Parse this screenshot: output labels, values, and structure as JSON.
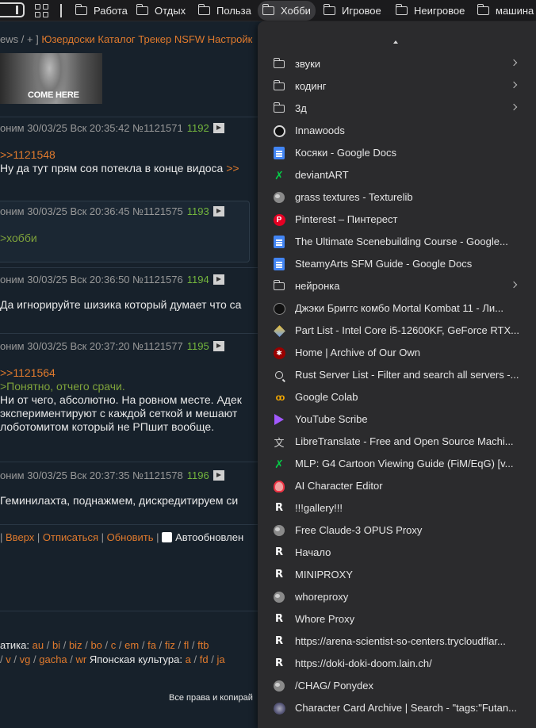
{
  "bookmarks_bar": {
    "items": [
      {
        "label": "Работа"
      },
      {
        "label": "Отдых"
      },
      {
        "label": "Польза"
      },
      {
        "label": "Хобби"
      },
      {
        "label": "Игровое"
      },
      {
        "label": "Неигровое"
      },
      {
        "label": "машина"
      }
    ]
  },
  "forum": {
    "topnav": {
      "prefix": "ews / + ]",
      "links": [
        "Юзердоски",
        "Каталог",
        "Трекер",
        "NSFW",
        "Настройк"
      ]
    },
    "thumb_caption": "COME HERE",
    "posts": [
      {
        "author": "оним",
        "date": "30/03/25 Вск 20:35:42",
        "postno": "№1121571",
        "index": "1192",
        "lines": [
          {
            "type": "reply",
            "text": ">>1121548"
          },
          {
            "type": "text",
            "text": "Ну да тут прям соя потекла в конце видоса",
            "trail": ">>"
          }
        ]
      },
      {
        "author": "оним",
        "date": "30/03/25 Вск 20:36:45",
        "postno": "№1121575",
        "index": "1193",
        "lines": [
          {
            "type": "quote",
            "text": ">хобби"
          }
        ]
      },
      {
        "author": "оним",
        "date": "30/03/25 Вск 20:36:50",
        "postno": "№1121576",
        "index": "1194",
        "lines": [
          {
            "type": "text",
            "text": "Да игнорируйте шизика который думает что са"
          }
        ]
      },
      {
        "author": "оним",
        "date": "30/03/25 Вск 20:37:20",
        "postno": "№1121577",
        "index": "1195",
        "lines": [
          {
            "type": "reply",
            "text": ">>1121564"
          },
          {
            "type": "quote",
            "text": ">Понятно, отчего срачи."
          },
          {
            "type": "text",
            "text": "Ни от чего, абсолютно. На ровном месте. Адек"
          },
          {
            "type": "text",
            "text": "экспериментируют с каждой сеткой и мешают"
          },
          {
            "type": "text",
            "text": "лоботомитом который не РПшит вообще."
          }
        ]
      },
      {
        "author": "оним",
        "date": "30/03/25 Вск 20:37:35",
        "postno": "№1121578",
        "index": "1196",
        "lines": [
          {
            "type": "text",
            "text": "Геминилахта, поднажмем, дискредитируем си"
          }
        ]
      }
    ],
    "bottom_links": {
      "links": [
        "Вверх",
        "Отписаться",
        "Обновить"
      ],
      "autoupdate_label": "Автообновлен"
    },
    "boards_line1": {
      "prefix": "атика:",
      "boards": [
        "au",
        "bi",
        "biz",
        "bo",
        "c",
        "em",
        "fa",
        "fiz",
        "fl",
        "ftb"
      ]
    },
    "boards_line2": {
      "boards_a": [
        "v",
        "vg",
        "gacha",
        "wr"
      ],
      "middle": "Японская культура:",
      "boards_b": [
        "a",
        "fd",
        "ja"
      ]
    },
    "copyright": "Все права и копирай"
  },
  "menu": {
    "items": [
      {
        "icon": "folder-icon",
        "label": "звуки",
        "submenu": true
      },
      {
        "icon": "folder-icon",
        "label": "кодинг",
        "submenu": true
      },
      {
        "icon": "folder-icon",
        "label": "3д",
        "submenu": true
      },
      {
        "icon": "github-icon",
        "label": "Innawoods"
      },
      {
        "icon": "google-docs-icon",
        "label": "Косяки - Google Docs"
      },
      {
        "icon": "deviantart-icon",
        "label": "deviantART"
      },
      {
        "icon": "globe-icon",
        "label": "grass textures - Texturelib"
      },
      {
        "icon": "pinterest-icon",
        "label": "Pinterest – Пинтерест"
      },
      {
        "icon": "google-docs-icon",
        "label": "The Ultimate Scenebuilding Course - Google..."
      },
      {
        "icon": "google-docs-icon",
        "label": "SteamyArts SFM Guide - Google Docs"
      },
      {
        "icon": "folder-icon",
        "label": "нейронка",
        "submenu": true
      },
      {
        "icon": "mortal-kombat-icon",
        "label": "Джэки Бриггс комбо Mortal Kombat 11 - Ли..."
      },
      {
        "icon": "pc-part-icon",
        "label": "Part List - Intel Core i5-12600KF, GeForce RTX..."
      },
      {
        "icon": "ao3-icon",
        "label": "Home | Archive of Our Own"
      },
      {
        "icon": "search-icon",
        "label": "Rust Server List - Filter and search all servers -..."
      },
      {
        "icon": "colab-icon",
        "label": "Google Colab"
      },
      {
        "icon": "youtube-scribe-icon",
        "label": "YouTube Scribe"
      },
      {
        "icon": "libretranslate-icon",
        "label": "LibreTranslate - Free and Open Source Machi..."
      },
      {
        "icon": "deviantart-icon",
        "label": "MLP: G4 Cartoon Viewing Guide (FiM/EqG) [v..."
      },
      {
        "icon": "ai-character-icon",
        "label": "AI Character Editor"
      },
      {
        "icon": "r-icon",
        "label": "!!!gallery!!!"
      },
      {
        "icon": "globe-icon",
        "label": "Free Claude-3 OPUS Proxy"
      },
      {
        "icon": "r-icon",
        "label": "Начало"
      },
      {
        "icon": "r-icon",
        "label": "MINIPROXY"
      },
      {
        "icon": "globe-icon",
        "label": "whoreproxy"
      },
      {
        "icon": "r-icon",
        "label": "Whore Proxy"
      },
      {
        "icon": "r-icon",
        "label": "https://arena-scientist-so-centers.trycloudflar..."
      },
      {
        "icon": "r-icon",
        "label": "https://doki-doki-doom.lain.ch/"
      },
      {
        "icon": "globe-icon",
        "label": "/CHAG/ Ponydex"
      },
      {
        "icon": "archive-icon",
        "label": "Character Card Archive | Search - \"tags:\"Futan..."
      }
    ]
  }
}
